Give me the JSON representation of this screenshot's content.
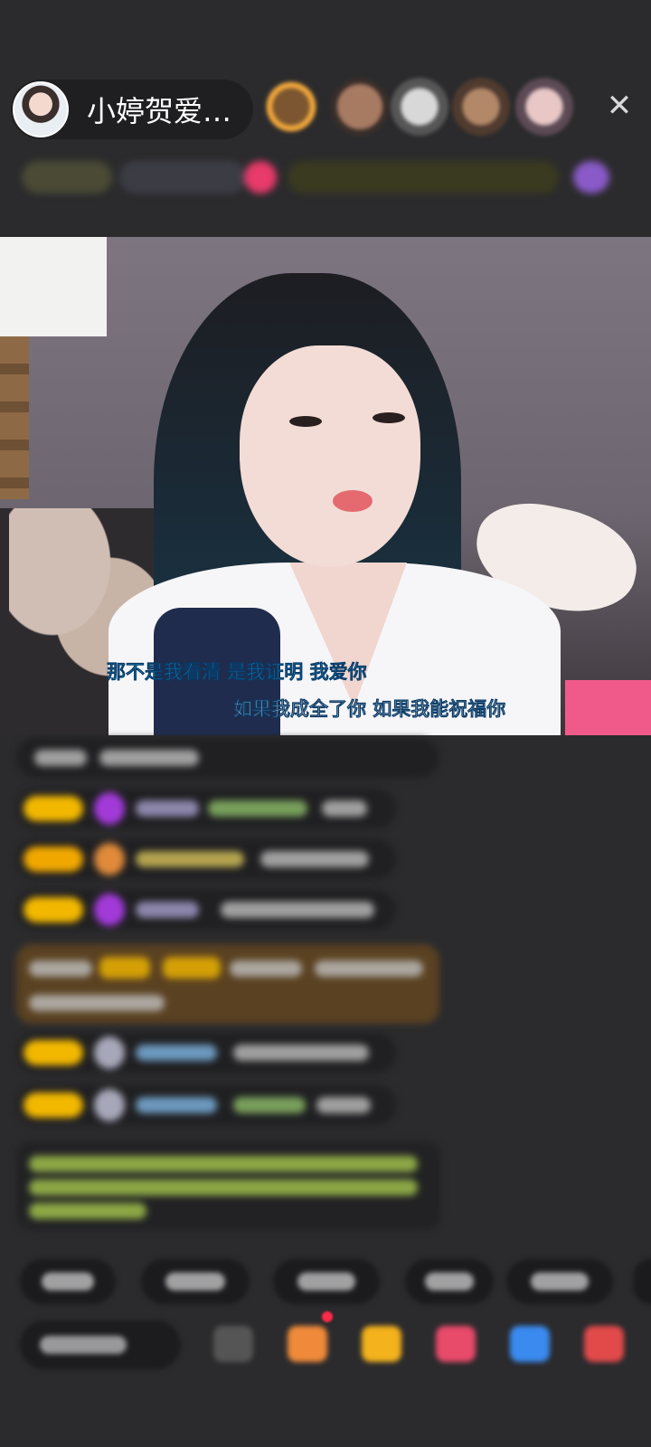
{
  "header": {
    "host_name": "小婷贺爱…",
    "close_glyph": "✕"
  },
  "video": {
    "subtitle_line1": "那不是我看清 是我证明 我爱你",
    "subtitle_line2": "如果我成全了你 如果我能祝福你"
  },
  "colors": {
    "background": "#2b2b2d",
    "level_badge": "#f2b800",
    "gift_highlight": "#5a4121",
    "subtitle_blue": "#1aa6e0",
    "notification_red": "#ff2a4a"
  },
  "icons": {
    "close": "close-icon",
    "host_avatar": "avatar",
    "bottom_bar": [
      "emoji-icon",
      "gift-box-icon",
      "gift-icon",
      "heart-icon",
      "game-icon",
      "more-icon"
    ]
  }
}
